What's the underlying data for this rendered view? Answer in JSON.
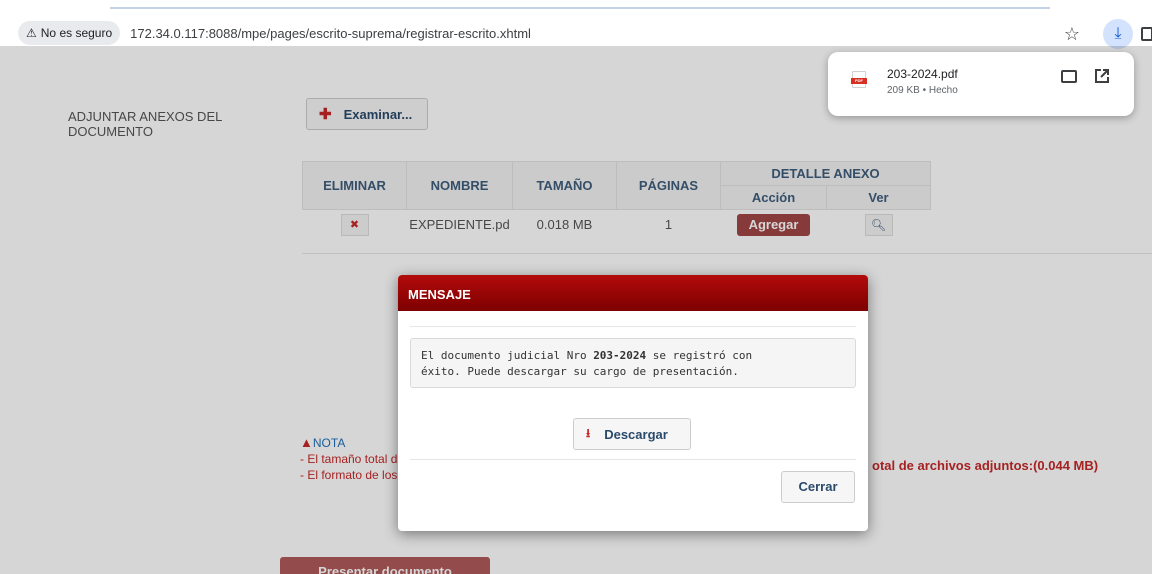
{
  "browser": {
    "security_label": "No es seguro",
    "url": "172.34.0.117:8088/mpe/pages/escrito-suprema/registrar-escrito.xhtml",
    "security_icon": "warning-icon",
    "bookmark_icon": "star-icon",
    "download_icon": "download-icon"
  },
  "download": {
    "file_name": "203-2024.pdf",
    "meta": "209 KB • Hecho",
    "pdf_badge": "PDF",
    "icons": [
      "pdf-file-icon",
      "folder-icon",
      "open-external-icon"
    ]
  },
  "page": {
    "attach_label": "ADJUNTAR ANEXOS DEL DOCUMENTO",
    "browse_button": "Examinar...",
    "table": {
      "headers": {
        "delete": "ELIMINAR",
        "name": "NOMBRE",
        "size": "TAMAÑO",
        "pages": "PÁGINAS",
        "detail": "DETALLE ANEXO",
        "action": "Acción",
        "view": "Ver"
      },
      "rows": [
        {
          "name": "EXPEDIENTE.pd",
          "size": "0.018 MB",
          "pages": "1",
          "action": "Agregar"
        }
      ]
    },
    "note_title": "NOTA",
    "note_line1": "- El tamaño total d",
    "note_line2": "- El formato de los",
    "total_text": "otal de archivos adjuntos:(0.044 MB)",
    "submit_button": "Presentar documento"
  },
  "modal": {
    "title": "MENSAJE",
    "message_pre": "El documento judicial Nro ",
    "message_number": "203-2024",
    "message_post": " se registró con",
    "message_line2": "éxito. Puede descargar su cargo de presentación.",
    "download_button": "Descargar",
    "close_button": "Cerrar"
  },
  "colors": {
    "modal_header": "#8b0000",
    "accent_red": "#c62828",
    "header_text": "#3f5d7d",
    "download_highlight": "#d3e3fd"
  }
}
